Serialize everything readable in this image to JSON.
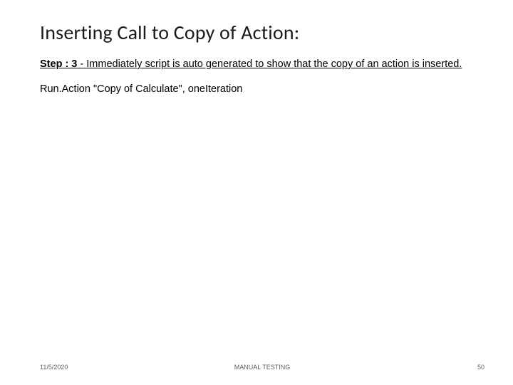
{
  "title": "Inserting Call to Copy of Action:",
  "step": {
    "label": "Step : 3",
    "text": " - Immediately script is auto generated to show that the copy of an action is inserted."
  },
  "code_line": "Run.Action \"Copy of Calculate\", oneIteration",
  "footer": {
    "date": "11/5/2020",
    "center": "MANUAL TESTING",
    "page": "50"
  }
}
